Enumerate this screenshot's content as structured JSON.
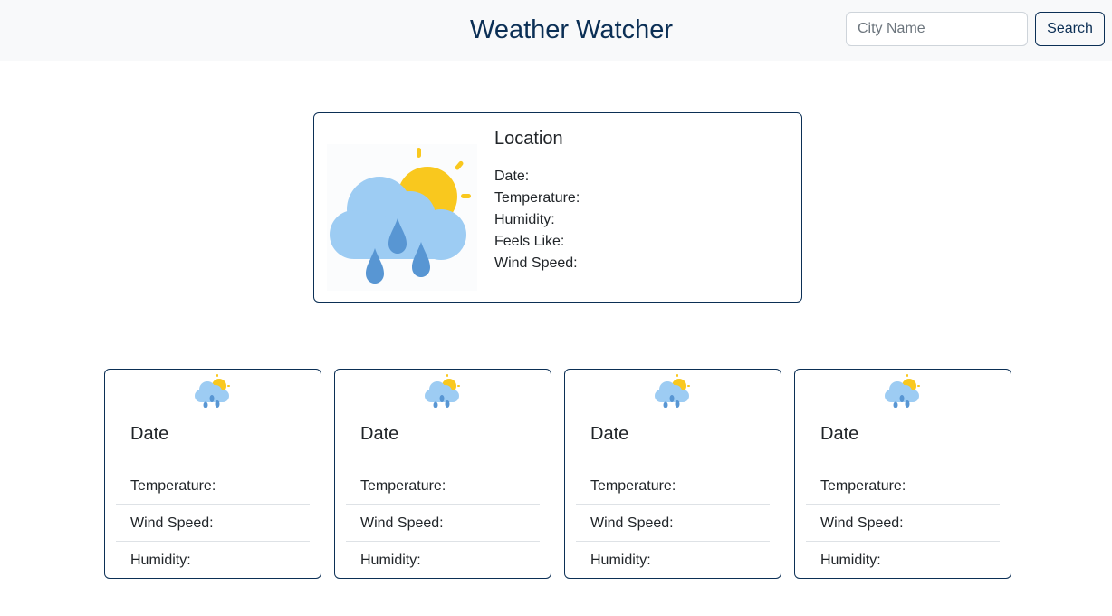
{
  "header": {
    "title": "Weather Watcher",
    "search_placeholder": "City Name",
    "search_value": "",
    "search_button": "Search"
  },
  "current": {
    "title": "Location",
    "icon": "sun-cloud-rain-icon",
    "date_label": "Date:",
    "temperature_label": "Temperature:",
    "humidity_label": "Humidity:",
    "feels_like_label": "Feels Like:",
    "wind_speed_label": "Wind Speed:"
  },
  "forecast": [
    {
      "icon": "sun-cloud-rain-icon",
      "date": "Date",
      "temperature_label": "Temperature:",
      "wind_speed_label": "Wind Speed:",
      "humidity_label": "Humidity:"
    },
    {
      "icon": "sun-cloud-rain-icon",
      "date": "Date",
      "temperature_label": "Temperature:",
      "wind_speed_label": "Wind Speed:",
      "humidity_label": "Humidity:"
    },
    {
      "icon": "sun-cloud-rain-icon",
      "date": "Date",
      "temperature_label": "Temperature:",
      "wind_speed_label": "Wind Speed:",
      "humidity_label": "Humidity:"
    },
    {
      "icon": "sun-cloud-rain-icon",
      "date": "Date",
      "temperature_label": "Temperature:",
      "wind_speed_label": "Wind Speed:",
      "humidity_label": "Humidity:"
    }
  ],
  "colors": {
    "brand": "#0b2f55",
    "cloud": "#9dccf3",
    "rain": "#5896d3",
    "sun": "#f9c81e"
  }
}
